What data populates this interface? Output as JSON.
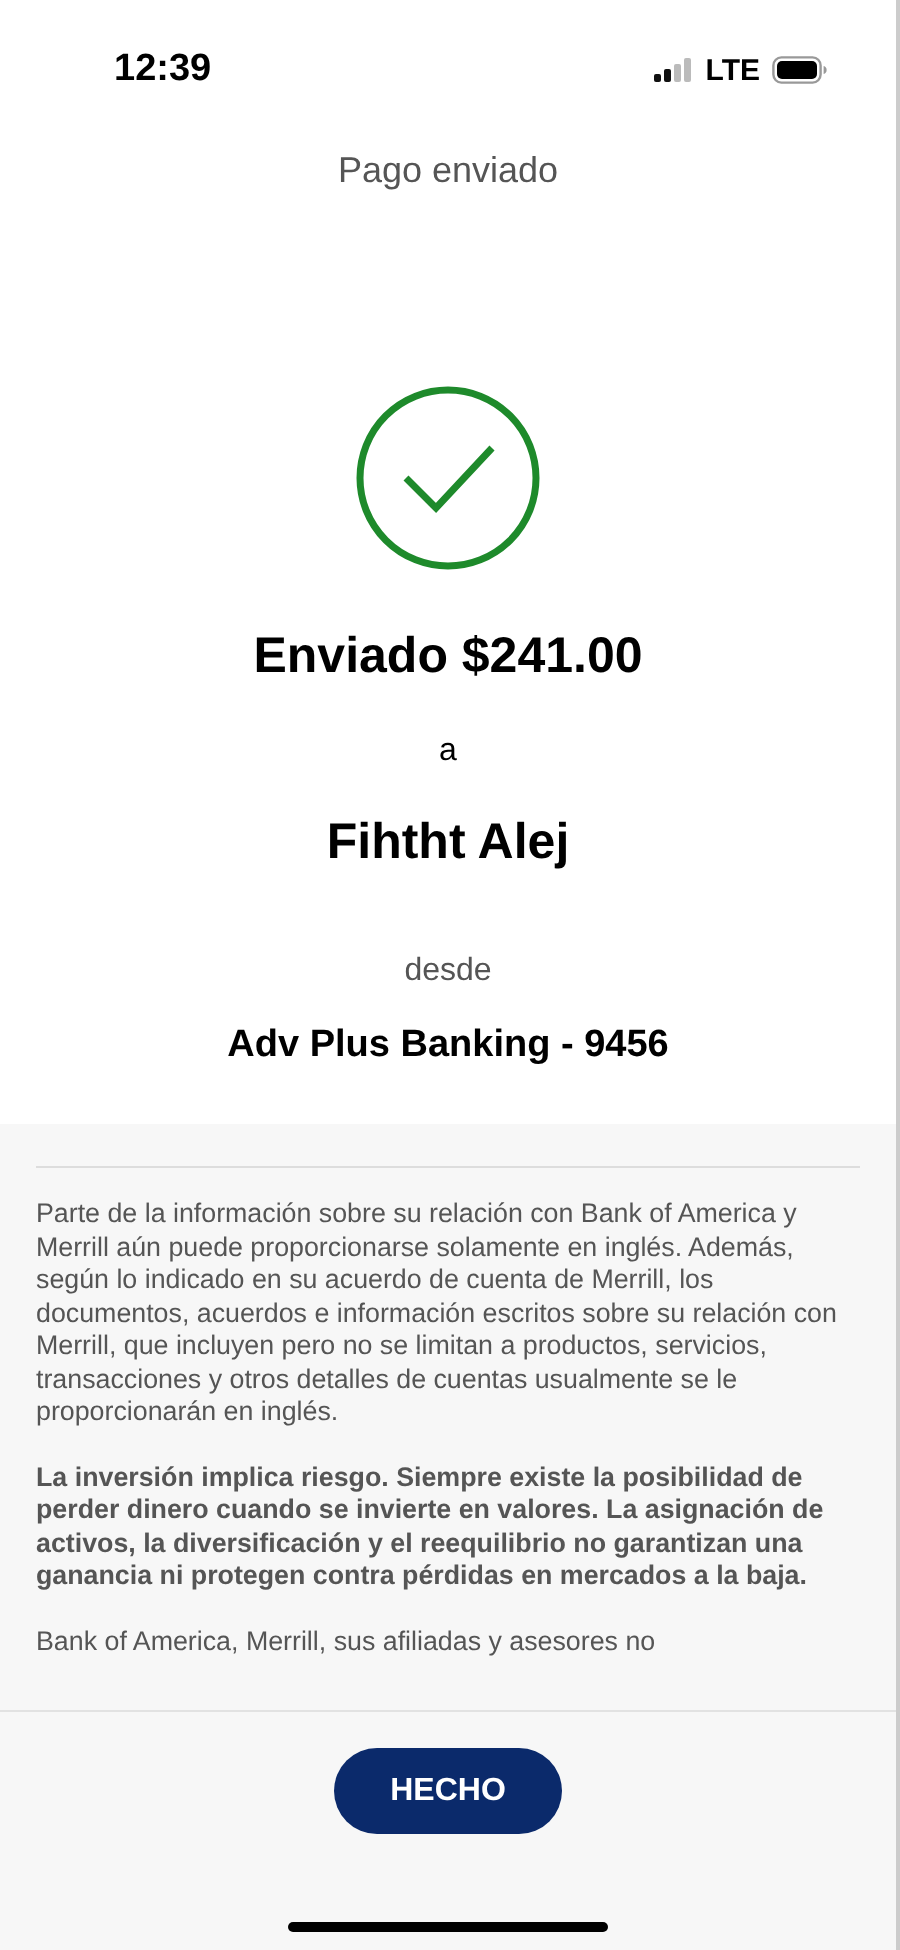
{
  "status_bar": {
    "time": "12:39",
    "network": "LTE"
  },
  "header": {
    "title": "Pago enviado"
  },
  "confirmation": {
    "amount_line": "Enviado $241.00",
    "to_word": "a",
    "recipient": "Fihtht Alej",
    "from_word": "desde",
    "account": "Adv Plus Banking - 9456"
  },
  "disclosures": [
    {
      "kind": "normal",
      "text": "Parte de la información sobre su relación con Bank of America y Merrill aún puede proporcionarse solamente en inglés. Además, según lo indicado en su acuerdo de cuenta de Merrill, los documentos, acuerdos e información escritos sobre su relación con Merrill, que incluyen pero no se limitan a productos, servicios, transacciones y otros detalles de cuentas usualmente se le proporcionarán en inglés."
    },
    {
      "kind": "bold",
      "text": "La inversión implica riesgo. Siempre existe la posibilidad de perder dinero cuando se invierte en valores. La asignación de activos, la diversificación y el reequilibrio no garantizan una ganancia ni protegen contra pérdidas en mercados a la baja."
    },
    {
      "kind": "normal",
      "text": "Bank of America, Merrill, sus afiliadas y asesores no"
    }
  ],
  "footer": {
    "button": "HECHO"
  }
}
